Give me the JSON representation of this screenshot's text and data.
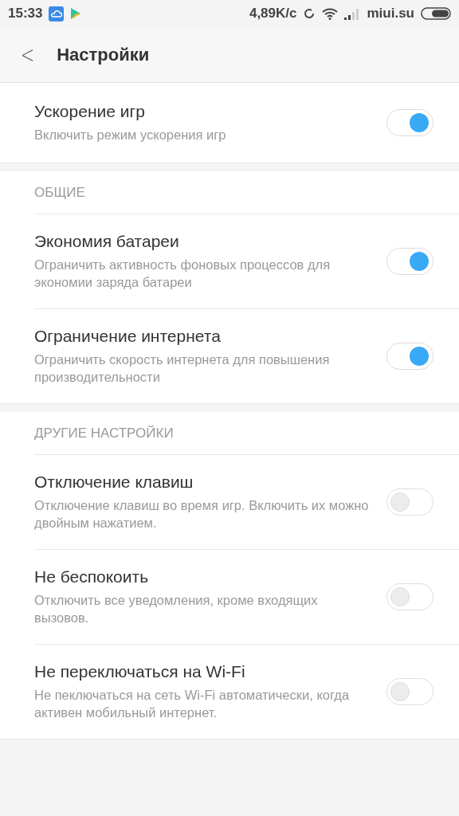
{
  "status_bar": {
    "time": "15:33",
    "speed": "4,89K/c",
    "carrier": "miui.su"
  },
  "header": {
    "back": "<",
    "title": "Настройки"
  },
  "sections": [
    {
      "items": [
        {
          "title": "Ускорение игр",
          "subtitle": "Включить режим ускорения игр",
          "on": true
        }
      ]
    },
    {
      "heading": "ОБЩИЕ",
      "items": [
        {
          "title": "Экономия батареи",
          "subtitle": "Ограничить активность фоновых процессов для экономии заряда батареи",
          "on": true
        },
        {
          "title": "Ограничение интернета",
          "subtitle": "Ограничить скорость интернета для повышения производительности",
          "on": true
        }
      ]
    },
    {
      "heading": "ДРУГИЕ НАСТРОЙКИ",
      "items": [
        {
          "title": "Отключение клавиш",
          "subtitle": "Отключение клавиш во время игр. Включить их можно двойным нажатием.",
          "on": false
        },
        {
          "title": "Не беспокоить",
          "subtitle": "Отключить все уведомления, кроме входящих вызовов.",
          "on": false
        },
        {
          "title": "Не переключаться на Wi-Fi",
          "subtitle": "Не пеключаться на сеть Wi-Fi автоматически, когда активен мобильный интернет.",
          "on": false
        }
      ]
    }
  ]
}
